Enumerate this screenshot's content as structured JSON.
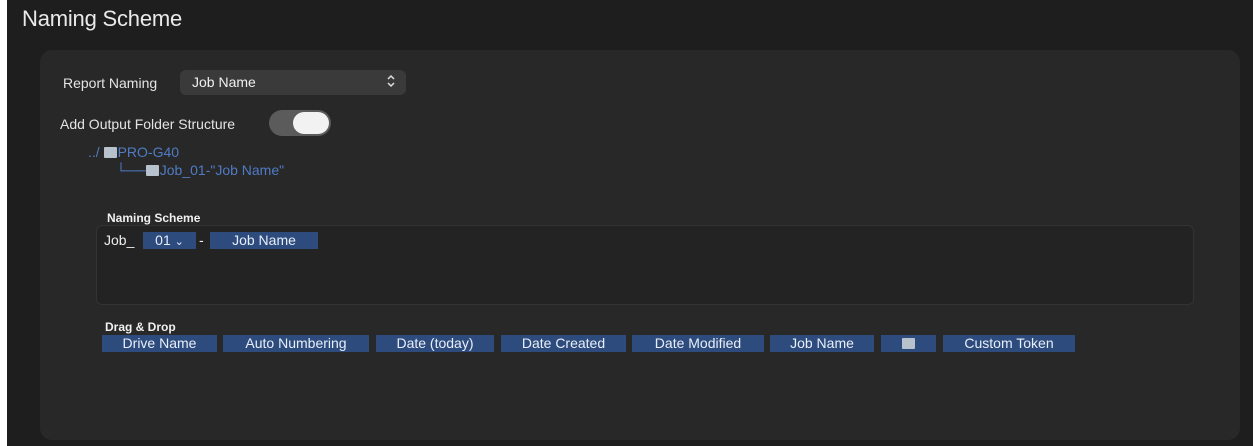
{
  "window": {
    "title": "Naming Scheme"
  },
  "report_naming": {
    "label": "Report Naming",
    "value": "Job Name",
    "icon": "chevron-updown-icon"
  },
  "output_folder": {
    "label": "Add Output Folder Structure",
    "toggle_on": true,
    "tree": {
      "prefix": "../",
      "root": "PRO-G40",
      "branch": "└──",
      "child": "Job_01-\"Job Name\""
    }
  },
  "naming_scheme": {
    "label": "Naming Scheme",
    "prefix": "Job_",
    "number_token": "01",
    "number_chevron": "⌄",
    "separator": "-",
    "name_token": "Job Name"
  },
  "drag_drop": {
    "label": "Drag & Drop",
    "tokens": [
      "Drive Name",
      "Auto Numbering",
      "Date (today)",
      "Date Created",
      "Date Modified",
      "Job Name",
      "",
      "Custom Token"
    ]
  },
  "colors": {
    "token_bg": "#2d4c7d",
    "link_blue": "#4f7bc4",
    "panel_bg": "#282828"
  }
}
